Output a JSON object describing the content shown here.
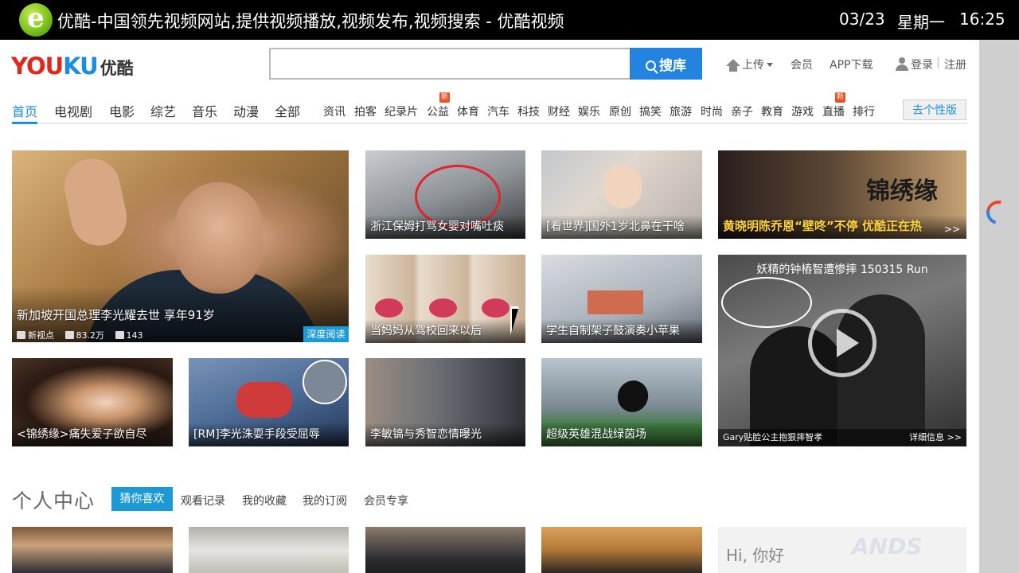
{
  "system_bar": {
    "title": "优酷-中国领先视频网站,提供视频播放,视频发布,视频搜索 - 优酷视频",
    "date": "03/23",
    "weekday": "星期一",
    "time": "16:25"
  },
  "brand": {
    "logo_part1": "YOU",
    "logo_part2": "KU",
    "logo_cn": "优酷"
  },
  "search": {
    "button_label": "搜库",
    "value": ""
  },
  "header_links": {
    "upload": "上传",
    "member": "会员",
    "app_download": "APP下载",
    "login": "登录",
    "separator": "|",
    "register": "注册"
  },
  "nav": {
    "main": [
      "首页",
      "电视剧",
      "电影",
      "综艺",
      "音乐",
      "动漫",
      "全部"
    ],
    "sub": [
      "资讯",
      "拍客",
      "纪录片",
      "公益",
      "体育",
      "汽车",
      "科技",
      "财经",
      "娱乐",
      "原创",
      "搞笑",
      "旅游",
      "时尚",
      "亲子",
      "教育",
      "游戏",
      "直播",
      "排行"
    ],
    "new_badge": "新",
    "personalize_button": "去个性版"
  },
  "featured": {
    "headline": "新加坡开国总理李光耀去世 享年91岁",
    "source": "新视点",
    "views": "83.2万",
    "comments": "143",
    "tag": "深度阅读"
  },
  "tiles": {
    "a1": "浙江保姆打骂女婴对嘴吐痰",
    "a2": "[看世界]国外1岁北鼻在干啥",
    "a3": "黄晓明陈乔恩“壁咚”不停  优酷正在热",
    "a3_brand": "锦绣缘",
    "a3_more": ">>",
    "b1": "当妈妈从驾校回来以后",
    "b2": "学生自制架子鼓演奏小苹果",
    "big2_top": "妖精的钟樁智遭惨摔 150315 Run",
    "big2_caption": "Gary贴脸公主抱狠摔智孝",
    "big2_more": "详细信息 >>",
    "c1": "<锦绣缘>痛失爱子欲自尽",
    "c2": "[RM]李光洙耍手段受屈辱",
    "c3": "李敏镐与秀智恋情曝光",
    "c4": "超级英雄混战绿茵场"
  },
  "personal_center": {
    "title": "个人中心",
    "tabs": [
      "猜你喜欢",
      "观看记录",
      "我的收藏",
      "我的订阅",
      "会员专享"
    ],
    "greeting": "Hi, 你好"
  },
  "watermark": "ANDS",
  "colors": {
    "accent": "#1a8ee1",
    "search_button": "#2384e0",
    "logo_red": "#e1261c",
    "badge": "#f04e23"
  }
}
